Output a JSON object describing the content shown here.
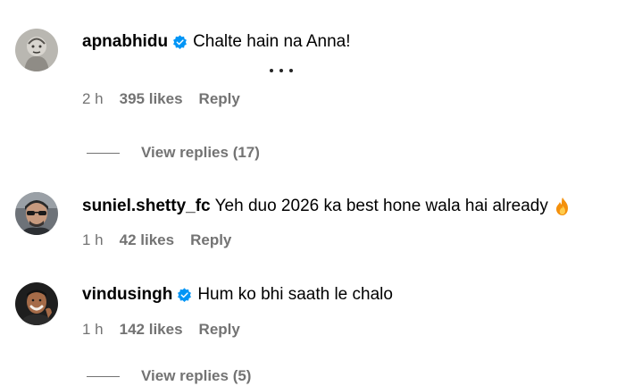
{
  "comments": [
    {
      "username": "apnabhidu",
      "verified": true,
      "text": "Chalte hain na Anna!",
      "time": "2 h",
      "likes": "395 likes",
      "reply_label": "Reply",
      "avatar_icon": "sketch-portrait-avatar"
    },
    {
      "username": "suniel.shetty_fc",
      "verified": false,
      "text": "Yeh duo 2026 ka best hone wala hai already",
      "emoji": "fire-icon",
      "time": "1 h",
      "likes": "42 likes",
      "reply_label": "Reply",
      "avatar_icon": "photo-avatar-man-sunglasses"
    },
    {
      "username": "vindusingh",
      "verified": true,
      "text": "Hum ko bhi saath le chalo",
      "time": "1 h",
      "likes": "142 likes",
      "reply_label": "Reply",
      "avatar_icon": "photo-avatar-man-smiling"
    }
  ],
  "view_replies": [
    {
      "label": "View replies (17)"
    },
    {
      "label": "View replies (5)"
    }
  ],
  "colors": {
    "verified_badge": "#0095f6",
    "secondary_text": "#737373",
    "primary_text": "#000000"
  }
}
